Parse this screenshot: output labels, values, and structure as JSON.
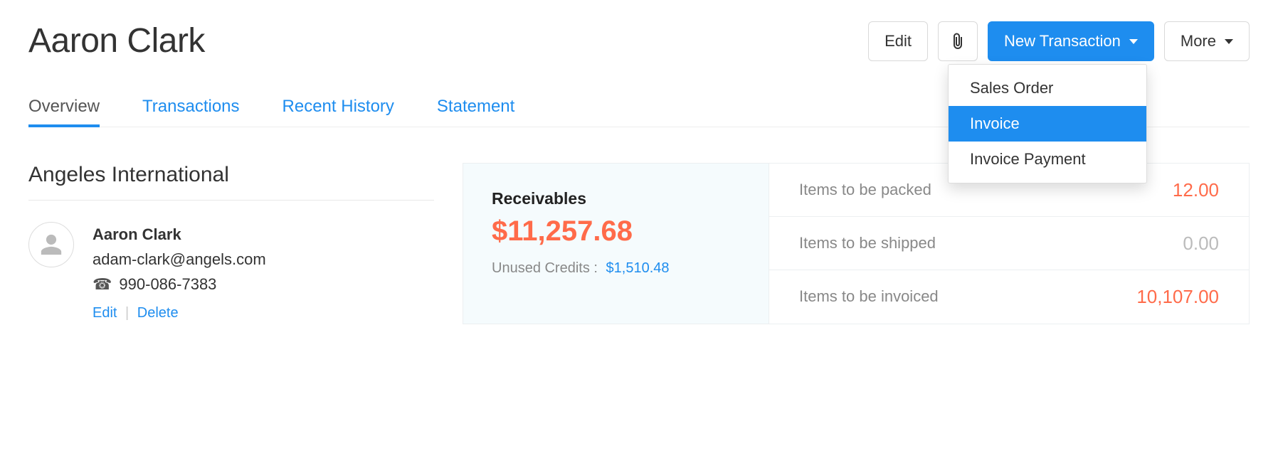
{
  "header": {
    "title": "Aaron Clark",
    "edit_label": "Edit",
    "new_transaction_label": "New Transaction",
    "more_label": "More"
  },
  "dropdown": {
    "items": [
      {
        "label": "Sales Order",
        "active": false
      },
      {
        "label": "Invoice",
        "active": true
      },
      {
        "label": "Invoice Payment",
        "active": false
      }
    ]
  },
  "tabs": [
    {
      "label": "Overview",
      "active": true
    },
    {
      "label": "Transactions",
      "active": false
    },
    {
      "label": "Recent History",
      "active": false
    },
    {
      "label": "Statement",
      "active": false
    }
  ],
  "overview": {
    "company": "Angeles International",
    "contact": {
      "name": "Aaron Clark",
      "email": "adam-clark@angels.com",
      "phone": "990-086-7383",
      "edit_label": "Edit",
      "delete_label": "Delete"
    },
    "receivables": {
      "title": "Receivables",
      "amount": "$11,257.68",
      "unused_label": "Unused Credits :",
      "unused_value": "$1,510.48"
    },
    "stats": [
      {
        "label": "Items to be packed",
        "value": "12.00",
        "style": "orange"
      },
      {
        "label": "Items to be shipped",
        "value": "0.00",
        "style": "gray"
      },
      {
        "label": "Items to be invoiced",
        "value": "10,107.00",
        "style": "orange"
      }
    ]
  }
}
